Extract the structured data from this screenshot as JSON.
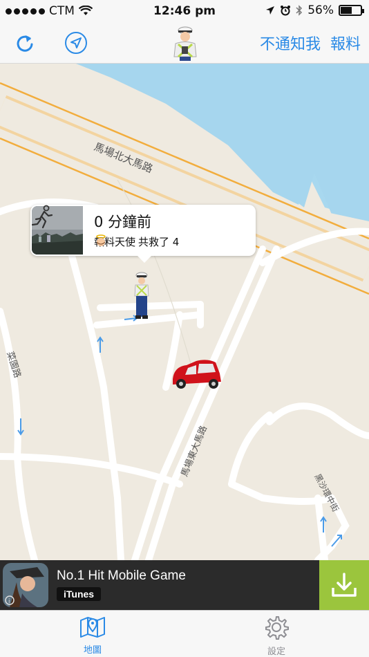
{
  "status_bar": {
    "carrier": "CTM",
    "time": "12:46 pm",
    "battery_percent": "56%",
    "battery_level": 0.56
  },
  "nav": {
    "refresh_icon": "refresh-icon",
    "locate_icon": "location-arrow-icon",
    "mute_label": "不通知我",
    "report_label": "報料",
    "accent_color": "#2a8ae6"
  },
  "map": {
    "road_labels": {
      "north": "馬場北大馬路",
      "east": "馬場東大馬路",
      "west": "菜園路",
      "southeast": "黑沙環中街"
    },
    "callout": {
      "time_label": "0 分鐘前",
      "reporter_label": "報料天使",
      "rescued_label": "共救了 4"
    }
  },
  "ad": {
    "title": "No.1 Hit Mobile Game",
    "store": "iTunes",
    "download_color": "#9bc53d"
  },
  "tabs": [
    {
      "label": "地圖",
      "icon": "map-icon",
      "active": true
    },
    {
      "label": "設定",
      "icon": "gear-icon",
      "active": false
    }
  ]
}
